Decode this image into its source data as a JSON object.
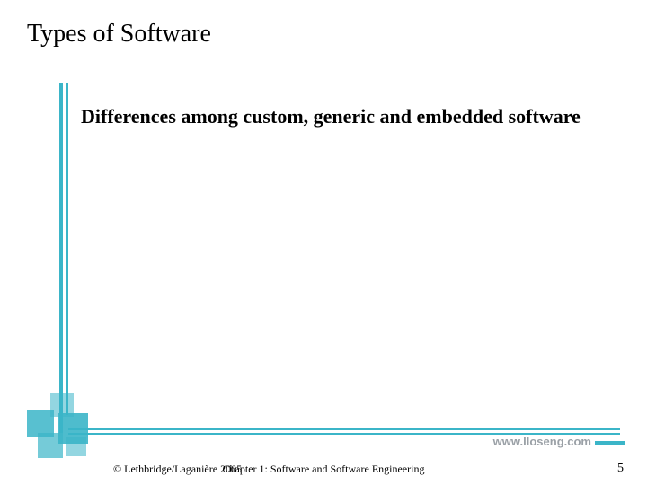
{
  "title": "Types of Software",
  "subtitle": "Differences among custom, generic and embedded software",
  "url": "www.lloseng.com",
  "footer": {
    "copyright": "© Lethbridge/Laganière 2005",
    "chapter": "Chapter 1: Software and Software Engineering",
    "page_number": "5"
  },
  "accent_color": "#3bb5c8"
}
